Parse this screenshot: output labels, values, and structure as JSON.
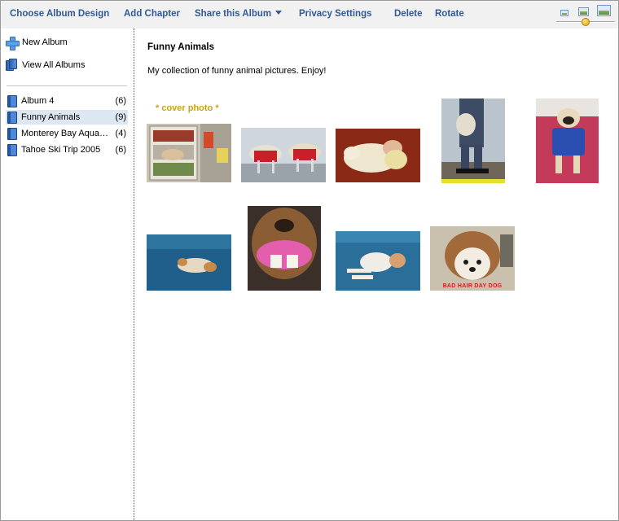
{
  "toolbar": {
    "choose_design": "Choose Album Design",
    "add_chapter": "Add Chapter",
    "share": "Share this Album",
    "privacy": "Privacy Settings",
    "delete": "Delete",
    "rotate": "Rotate",
    "thumbnail_size": {
      "icons": [
        "small-thumbnail-icon",
        "medium-thumbnail-icon",
        "large-thumbnail-icon"
      ],
      "slider_level": 0.5
    }
  },
  "sidebar": {
    "new_album": "New Album",
    "view_all": "View All Albums",
    "albums": [
      {
        "name": "Album 4",
        "count": "(6)",
        "selected": false
      },
      {
        "name": "Funny Animals",
        "count": "(9)",
        "selected": true
      },
      {
        "name": "Monterey Bay Aquarium",
        "count": "(4)",
        "selected": false
      },
      {
        "name": "Tahoe Ski Trip 2005",
        "count": "(6)",
        "selected": false
      }
    ]
  },
  "main": {
    "title": "Funny Animals",
    "description": "My collection of funny animal pictures. Enjoy!",
    "cover_label": "* cover photo *",
    "photos": [
      {
        "name": "cat in refrigerator",
        "cover": true
      },
      {
        "name": "dogs in red jackets"
      },
      {
        "name": "dog sleeping with baby"
      },
      {
        "name": "dog carried in backpack"
      },
      {
        "name": "pug in blue carrier"
      },
      {
        "name": "cat sleeping on blue couch"
      },
      {
        "name": "dog with toy teeth"
      },
      {
        "name": "puppy sprawled on couch"
      },
      {
        "name": "shih tzu with wig",
        "caption": "BAD HAIR DAY DOG"
      }
    ]
  },
  "colors": {
    "toolbar_link": "#2f5a92",
    "cover_label": "#d2a10a",
    "selected_row": "#dde7f2",
    "toolbar_bg": "#f1f1f1"
  }
}
